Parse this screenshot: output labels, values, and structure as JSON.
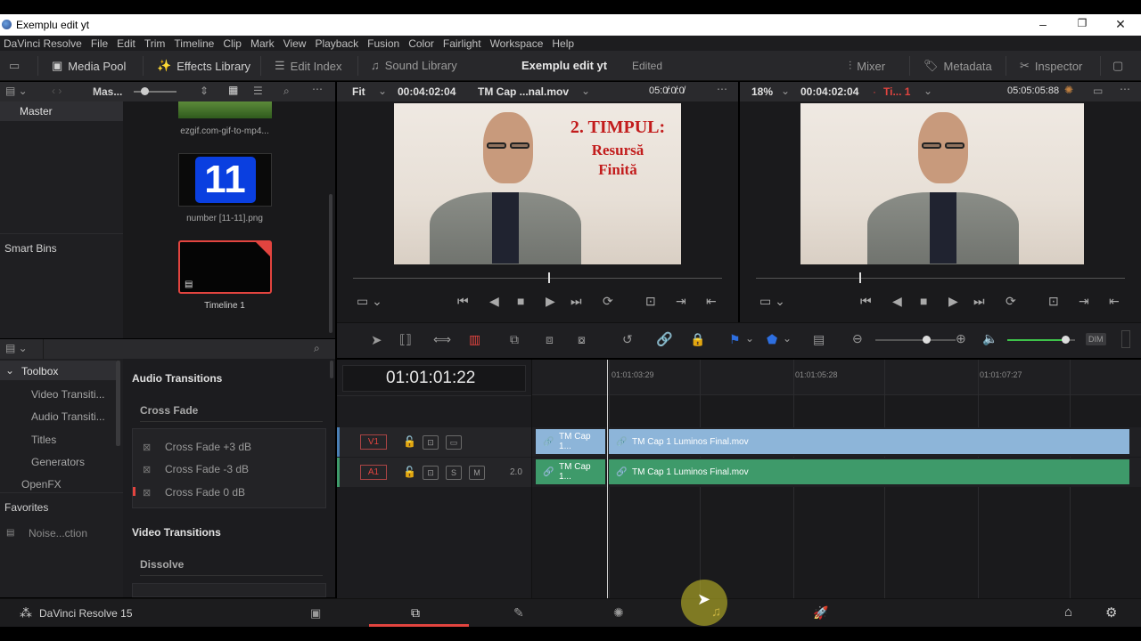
{
  "window": {
    "title": "Exemplu edit yt"
  },
  "menu": [
    "DaVinci Resolve",
    "File",
    "Edit",
    "Trim",
    "Timeline",
    "Clip",
    "Mark",
    "View",
    "Playback",
    "Fusion",
    "Color",
    "Fairlight",
    "Workspace",
    "Help"
  ],
  "toolbar": {
    "media_pool": "Media Pool",
    "effects_library": "Effects Library",
    "edit_index": "Edit Index",
    "sound_library": "Sound Library",
    "project_title": "Exemplu edit yt",
    "status": "Edited",
    "mixer": "Mixer",
    "metadata": "Metadata",
    "inspector": "Inspector"
  },
  "media_pool": {
    "bin_label": "Mas...",
    "master": "Master",
    "smart_bins": "Smart Bins",
    "clips": [
      {
        "name": "ezgif.com-gif-to-mp4..."
      },
      {
        "name": "number [11-11].png",
        "thumb_text": "11"
      },
      {
        "name": "Timeline 1"
      }
    ]
  },
  "source_viewer": {
    "zoom": "Fit",
    "timecode": "00:04:02:04",
    "clip_name": "TM Cap ...nal.mov",
    "duration": "05:0̸:0̸:0̸",
    "overlay_line1": "2. TIMPUL:",
    "overlay_line2": "Resursă",
    "overlay_line3": "Finită",
    "playhead_fraction": 0.53
  },
  "timeline_viewer": {
    "zoom": "18%",
    "timecode": "00:04:02:04",
    "timeline_name": "Ti... 1",
    "duration": "05:05:05:88",
    "playhead_fraction": 0.28
  },
  "effects": {
    "toolbox": "Toolbox",
    "items": [
      "Video Transiti...",
      "Audio Transiti...",
      "Titles",
      "Generators",
      "OpenFX"
    ],
    "favorites": "Favorites",
    "favorite_items": [
      "Noise...ction"
    ],
    "audio_transitions_header": "Audio Transitions",
    "cross_fade_group": "Cross Fade",
    "cross_fades": [
      "Cross Fade +3 dB",
      "Cross Fade -3 dB",
      "Cross Fade 0 dB"
    ],
    "video_transitions_header": "Video Transitions",
    "dissolve_group": "Dissolve"
  },
  "timeline": {
    "timecode": "01:01:01:22",
    "ruler": [
      "01:01:03:29",
      "01:01:05:28",
      "01:01:07:27"
    ],
    "tracks": {
      "v1": {
        "label": "V1",
        "clip_short": "TM Cap 1...",
        "clip_full": "TM Cap 1 Luminos Final.mov"
      },
      "a1": {
        "label": "A1",
        "level": "2.0",
        "solo": "S",
        "mute": "M",
        "clip_short": "TM Cap 1...",
        "clip_full": "TM Cap 1 Luminos Final.mov"
      }
    },
    "volume_fraction": 0.85,
    "dim": "DIM"
  },
  "footer": {
    "app": "DaVinci Resolve 15"
  },
  "colors": {
    "accent_red": "#e2443f",
    "video_clip": "#8db5d9",
    "audio_clip": "#3e9a6a",
    "flag_blue": "#2e6fe0"
  },
  "icons": [
    "monitor-icon",
    "media-pool-icon",
    "effects-library-icon",
    "edit-index-icon",
    "sound-library-icon",
    "mixer-icon",
    "metadata-icon",
    "inspector-icon",
    "search-icon",
    "lock-icon",
    "link-icon",
    "razor-icon",
    "play-icon",
    "stop-icon",
    "skip-back-icon",
    "skip-forward-icon",
    "loop-icon",
    "home-icon",
    "gear-icon"
  ]
}
